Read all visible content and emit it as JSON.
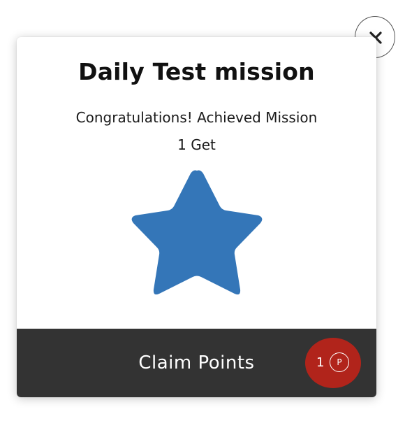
{
  "modal": {
    "title": "Daily Test mission",
    "message_line1": "Congratulations! Achieved Mission",
    "message_line2": "1 Get",
    "star_icon": "star-icon",
    "star_color": "#3476b8",
    "close_icon": "close-icon"
  },
  "footer": {
    "claim_label": "Claim Points",
    "points_count": "1",
    "points_symbol": "P",
    "background": "#333333",
    "badge_color": "#b1241b"
  }
}
